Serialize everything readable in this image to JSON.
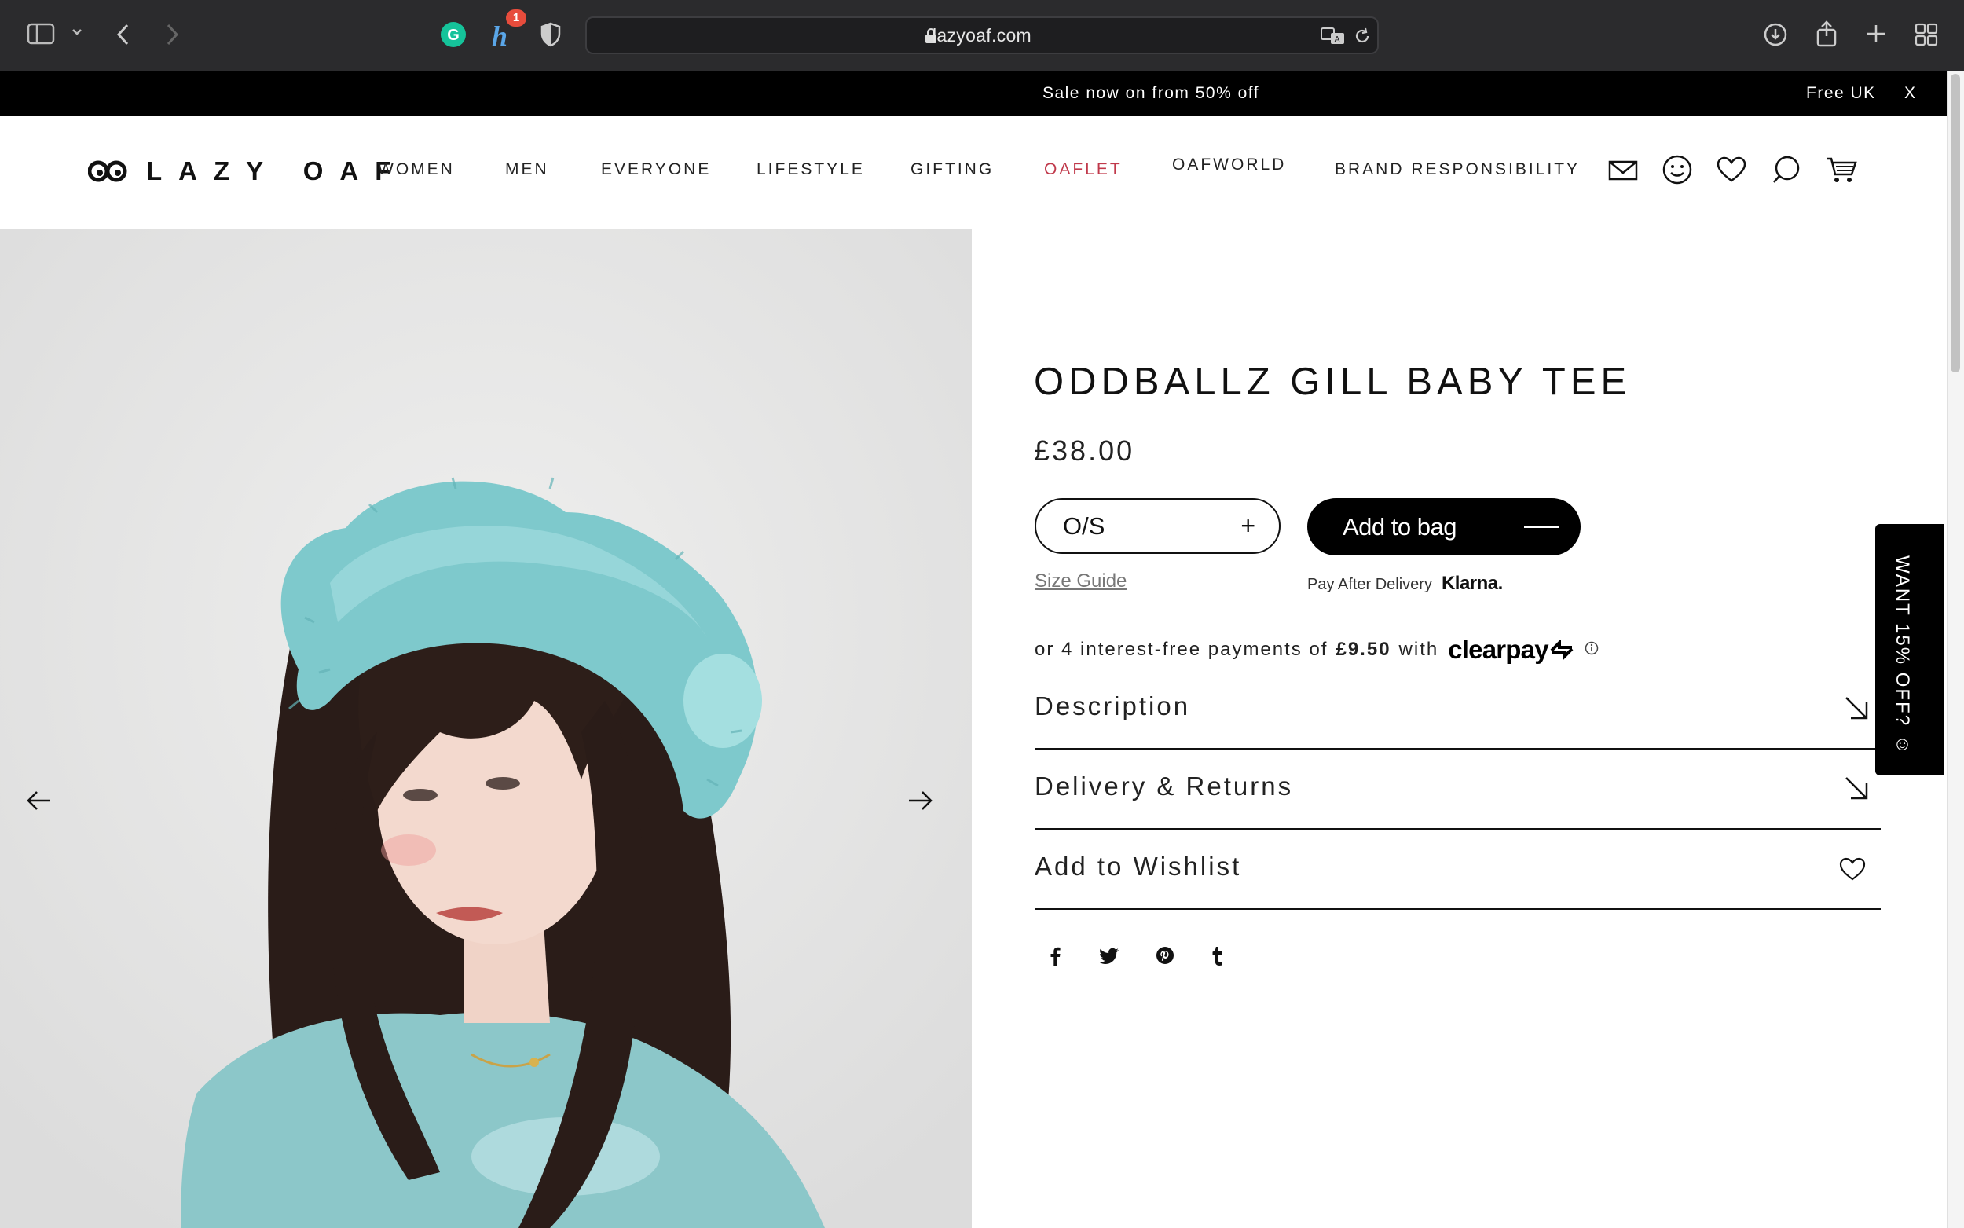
{
  "browser": {
    "url": "lazyoaf.com",
    "extension_badge": "1"
  },
  "promo": {
    "message": "Sale now on from 50% off",
    "right_text": "Free UK",
    "close": "X"
  },
  "header": {
    "logo": "LAZY OAF",
    "nav": [
      "WOMEN",
      "MEN",
      "EVERYONE",
      "LIFESTYLE",
      "GIFTING",
      "OAFLET",
      "OAFWORLD",
      "BRAND RESPONSIBILITY"
    ],
    "sale_color": "#c0394b"
  },
  "product": {
    "title": "ODDBALLZ GILL BABY TEE",
    "price": "£38.00",
    "size_value": "O/S",
    "size_plus": "+",
    "add_to_bag": "Add to bag",
    "size_guide": "Size Guide",
    "klarna_text": "Pay After Delivery",
    "klarna_brand": "Klarna.",
    "clearpay_prefix": "or 4 interest-free payments of",
    "clearpay_amount": "£9.50",
    "clearpay_with": "with",
    "clearpay_brand": "clearpay",
    "accordion": [
      "Description",
      "Delivery & Returns",
      "Add to Wishlist"
    ]
  },
  "popup_tab": "WANT 15% OFF? ☺",
  "image": {
    "hat_color": "#7ec9cc",
    "tee_color": "#8cc7c9"
  }
}
